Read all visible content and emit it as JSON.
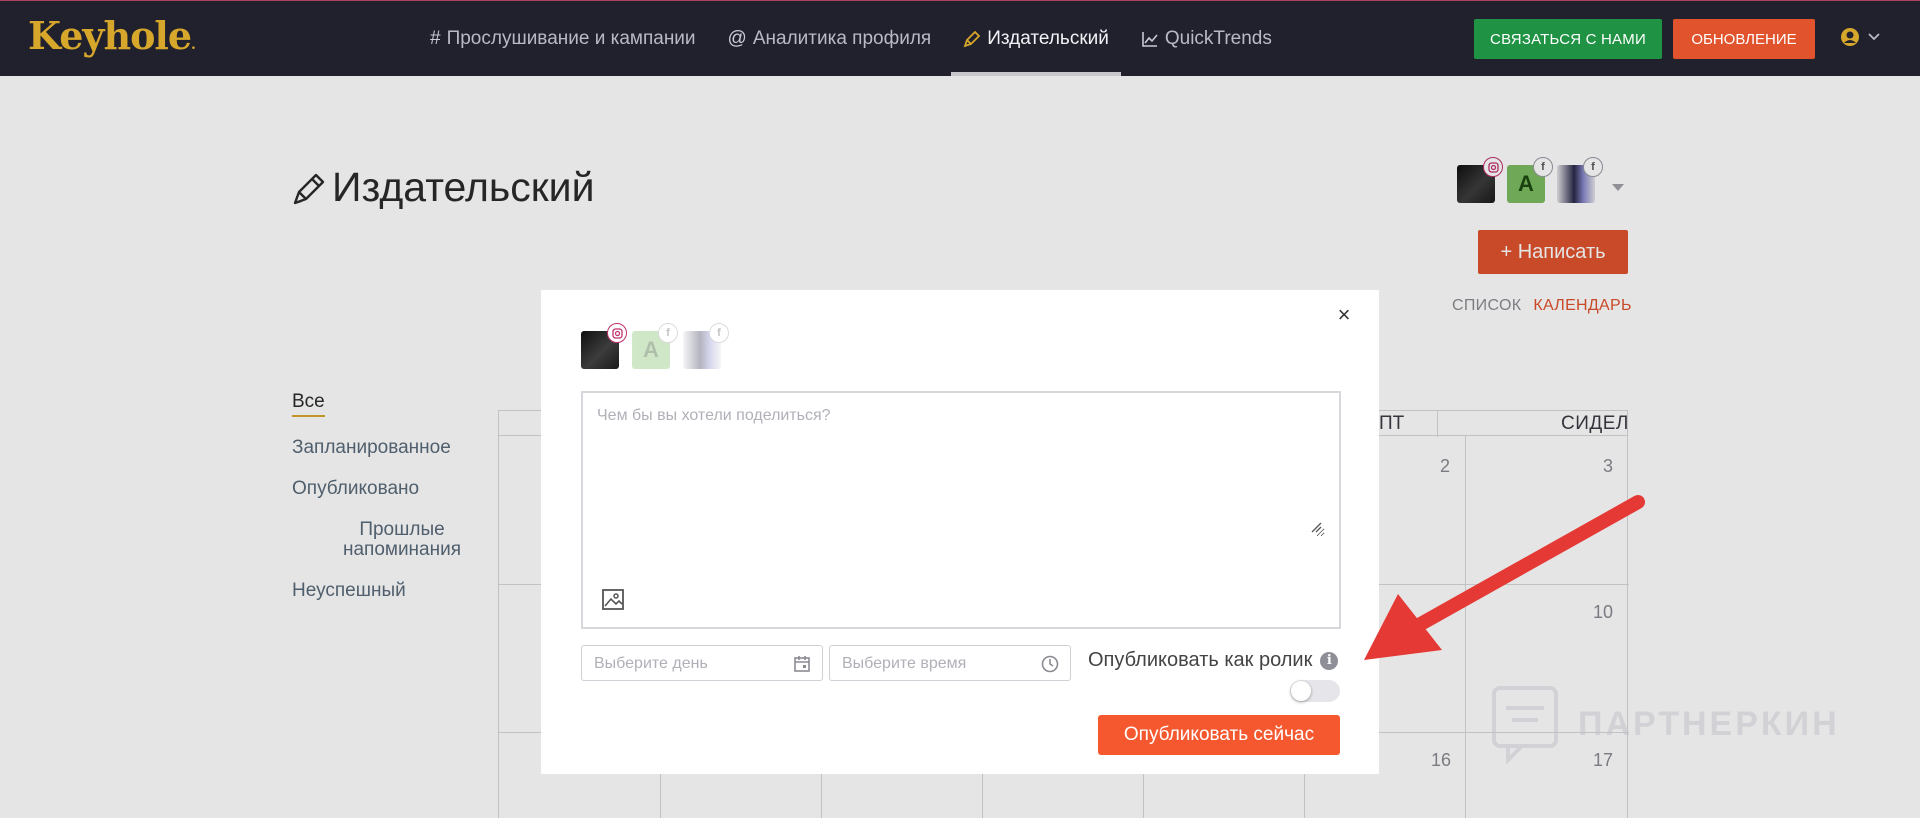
{
  "brand": {
    "logo": "Keyhole",
    "accent": "#d6a72b"
  },
  "nav": {
    "items": [
      {
        "icon": "#",
        "label": "Прослушивание и кампании"
      },
      {
        "icon": "@",
        "label": "Аналитика профиля"
      },
      {
        "icon": "pen-icon",
        "label": "Издательский",
        "active": true
      },
      {
        "icon": "trend-chart-icon",
        "label": "QuickTrends"
      }
    ],
    "contact_button": "СВЯЗАТЬСЯ С НАМИ",
    "upgrade_button": "ОБНОВЛЕНИЕ"
  },
  "page": {
    "title": "Издательский",
    "compose_button": "+ Написать",
    "view_list": "СПИСОК",
    "view_calendar": "КАЛЕНДАРЬ",
    "filters": [
      "Все",
      "Запланированное",
      "Опубликовано",
      "Прошлые напоминания",
      "Неуспешный"
    ]
  },
  "calendar": {
    "day_fri": "ПТ",
    "day_sun": "СИДЕЛ",
    "numbers": [
      "2",
      "3",
      "10",
      "16",
      "17"
    ]
  },
  "accounts": [
    {
      "network": "instagram",
      "initial": ""
    },
    {
      "network": "facebook",
      "initial": "A"
    },
    {
      "network": "facebook",
      "initial": ""
    }
  ],
  "modal": {
    "close": "×",
    "placeholder": "Чем бы вы хотели поделиться?",
    "day_placeholder": "Выберите день",
    "time_placeholder": "Выберите время",
    "reel_label": "Опубликовать как ролик",
    "info": "i",
    "publish_button": "Опубликовать сейчас",
    "reel_enabled": false
  },
  "watermark": "ПАРТНЕРКИН",
  "colors": {
    "primary": "#e0532d",
    "success": "#1f9343",
    "nav_bg": "#21212d"
  }
}
